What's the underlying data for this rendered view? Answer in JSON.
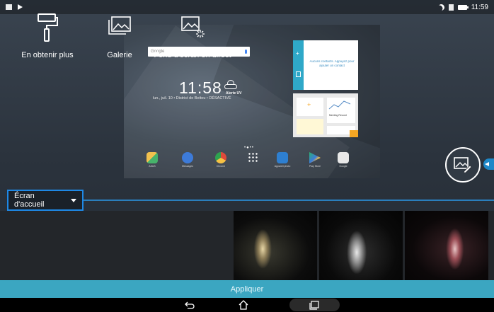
{
  "status_bar": {
    "time": "11:59"
  },
  "preview": {
    "search_hint": "Google",
    "clock": "11:58",
    "weather_alert": "Alerte UV",
    "date_line": "lun., juil. 10 • District de Beitou • DÉSACTIVÉ",
    "contacts_widget_text": "Aucuns contacts. Appuyez pour ajouter un contact",
    "memo_title": "Meeting Record",
    "dots": "•●••",
    "apps": [
      {
        "label": "ASUS",
        "color": "#f2c14e"
      },
      {
        "label": "Messages",
        "color": "#3d7bd9"
      },
      {
        "label": "Chrome",
        "color": "#e04a3a"
      },
      {
        "label": "",
        "color": "#3a4450"
      },
      {
        "label": "Appareil photo",
        "color": "#2e7fd0"
      },
      {
        "label": "Play Store",
        "color": "#2bb36c"
      },
      {
        "label": "Google",
        "color": "#e8e8e8"
      }
    ]
  },
  "dropdown": {
    "label": "Écran d'accueil"
  },
  "options": {
    "get_more": "En obtenir plus",
    "gallery": "Galerie",
    "live_wallpaper": "Fond d'écran en direct"
  },
  "apply_button": "Appliquer",
  "colors": {
    "accent": "#1e88e5",
    "apply_bg": "#3ba6c1"
  }
}
